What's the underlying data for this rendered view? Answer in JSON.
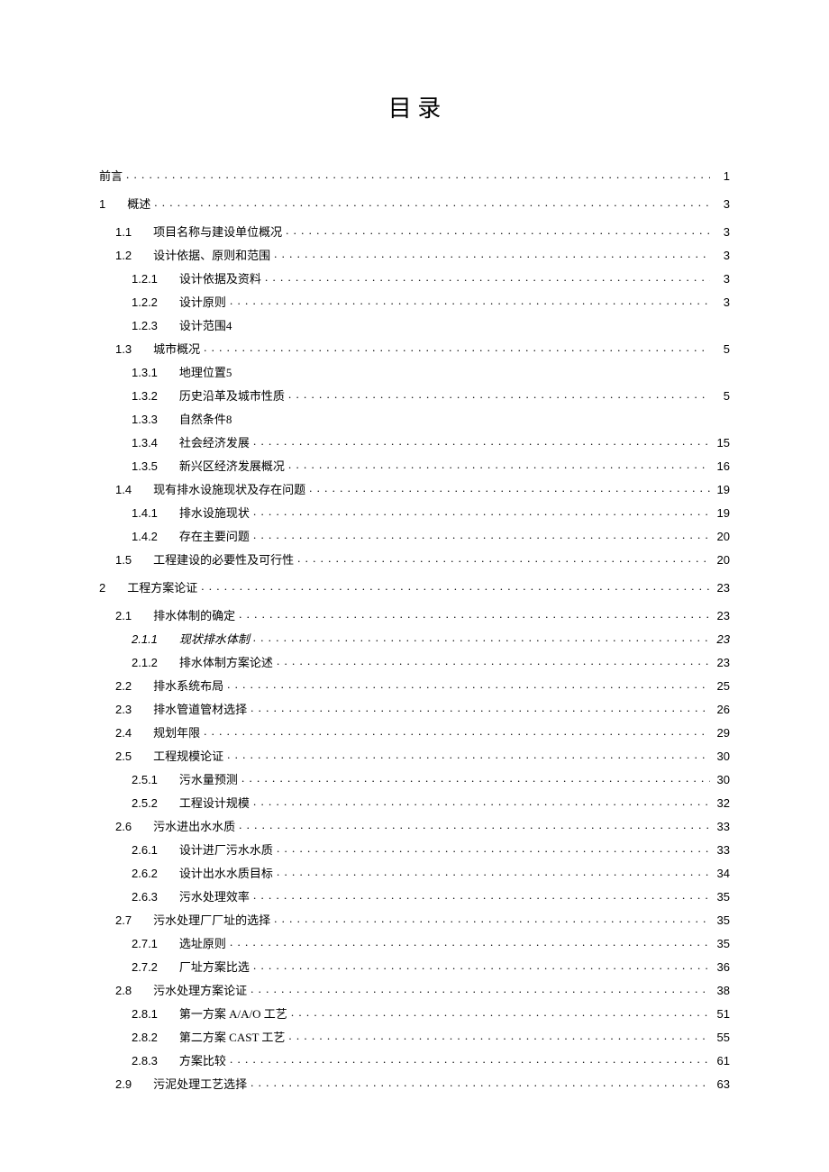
{
  "title": "目 录",
  "toc": [
    {
      "num": "前言",
      "text": "",
      "page": "1",
      "level": 0,
      "gap": true,
      "noNum": true
    },
    {
      "num": "1",
      "text": "概述",
      "page": "3",
      "level": 0,
      "gap": true
    },
    {
      "num": "1.1",
      "text": "项目名称与建设单位概况",
      "page": "3",
      "level": 1
    },
    {
      "num": "1.2",
      "text": "设计依据、原则和范围",
      "page": "3",
      "level": 1
    },
    {
      "num": "1.2.1",
      "text": "设计依据及资料",
      "page": "3",
      "level": 2
    },
    {
      "num": "1.2.2",
      "text": "设计原则",
      "page": "3",
      "level": 2
    },
    {
      "num": "1.2.3",
      "text": "设计范围4",
      "page": "",
      "level": 2,
      "nodots": true
    },
    {
      "num": "1.3",
      "text": "城市概况",
      "page": "5",
      "level": 1
    },
    {
      "num": "1.3.1",
      "text": "地理位置5",
      "page": "",
      "level": 2,
      "nodots": true
    },
    {
      "num": "1.3.2",
      "text": "历史沿革及城市性质",
      "page": "5",
      "level": 2
    },
    {
      "num": "1.3.3",
      "text": "自然条件8",
      "page": "",
      "level": 2,
      "nodots": true
    },
    {
      "num": "1.3.4",
      "text": "社会经济发展",
      "page": "15",
      "level": 2
    },
    {
      "num": "1.3.5",
      "text": "新兴区经济发展概况",
      "page": "16",
      "level": 2
    },
    {
      "num": "1.4",
      "text": "现有排水设施现状及存在问题",
      "page": "19",
      "level": 1
    },
    {
      "num": "1.4.1",
      "text": "排水设施现状",
      "page": "19",
      "level": 2
    },
    {
      "num": "1.4.2",
      "text": "存在主要问题",
      "page": "20",
      "level": 2
    },
    {
      "num": "1.5",
      "text": "工程建设的必要性及可行性",
      "page": "20",
      "level": 1
    },
    {
      "num": "2",
      "text": "工程方案论证",
      "page": "23",
      "level": 0,
      "gap": true
    },
    {
      "num": "2.1",
      "text": "排水体制的确定",
      "page": "23",
      "level": 1
    },
    {
      "num": "2.1.1",
      "text": "现状排水体制",
      "page": "23",
      "level": 2,
      "italic": true
    },
    {
      "num": "2.1.2",
      "text": "排水体制方案论述",
      "page": "23",
      "level": 2
    },
    {
      "num": "2.2",
      "text": "排水系统布局",
      "page": "25",
      "level": 1
    },
    {
      "num": "2.3",
      "text": "排水管道管材选择",
      "page": "26",
      "level": 1
    },
    {
      "num": "2.4",
      "text": "规划年限",
      "page": "29",
      "level": 1
    },
    {
      "num": "2.5",
      "text": "工程规模论证",
      "page": "30",
      "level": 1
    },
    {
      "num": "2.5.1",
      "text": "污水量预测",
      "page": "30",
      "level": 2
    },
    {
      "num": "2.5.2",
      "text": "工程设计规模",
      "page": "32",
      "level": 2
    },
    {
      "num": "2.6",
      "text": "污水进出水水质",
      "page": "33",
      "level": 1
    },
    {
      "num": "2.6.1",
      "text": "设计进厂污水水质",
      "page": "33",
      "level": 2
    },
    {
      "num": "2.6.2",
      "text": "设计出水水质目标",
      "page": "34",
      "level": 2
    },
    {
      "num": "2.6.3",
      "text": "污水处理效率",
      "page": "35",
      "level": 2
    },
    {
      "num": "2.7",
      "text": "污水处理厂厂址的选择",
      "page": "35",
      "level": 1
    },
    {
      "num": "2.7.1",
      "text": "选址原则",
      "page": "35",
      "level": 2
    },
    {
      "num": "2.7.2",
      "text": "厂址方案比选",
      "page": "36",
      "level": 2
    },
    {
      "num": "2.8",
      "text": "污水处理方案论证",
      "page": "38",
      "level": 1
    },
    {
      "num": "2.8.1",
      "text": "第一方案 A/A/O 工艺",
      "page": "51",
      "level": 2
    },
    {
      "num": "2.8.2",
      "text": "第二方案 CAST 工艺",
      "page": "55",
      "level": 2
    },
    {
      "num": "2.8.3",
      "text": "方案比较",
      "page": "61",
      "level": 2
    },
    {
      "num": "2.9",
      "text": "污泥处理工艺选择",
      "page": "63",
      "level": 1
    }
  ]
}
